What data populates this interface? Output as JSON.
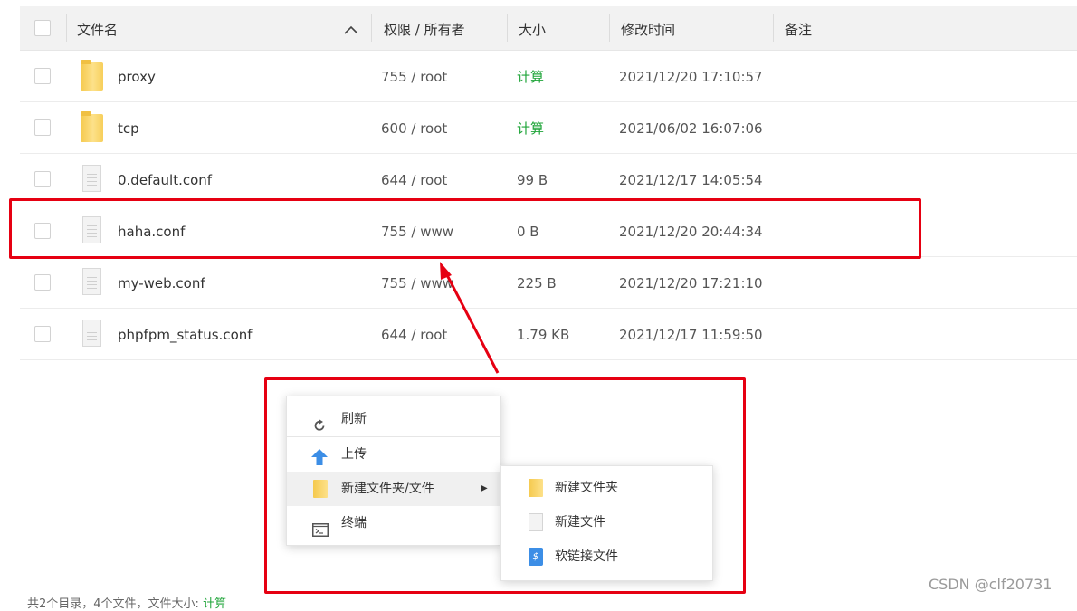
{
  "header": {
    "name": "文件名",
    "perm_owner": "权限 / 所有者",
    "size": "大小",
    "modified": "修改时间",
    "note": "备注"
  },
  "rows": [
    {
      "name": "proxy",
      "type": "folder",
      "perm": "755 / root",
      "size": "计算",
      "time": "2021/12/20 17:10:57"
    },
    {
      "name": "tcp",
      "type": "folder",
      "perm": "600 / root",
      "size": "计算",
      "time": "2021/06/02 16:07:06"
    },
    {
      "name": "0.default.conf",
      "type": "file",
      "perm": "644 / root",
      "size": "99 B",
      "time": "2021/12/17 14:05:54"
    },
    {
      "name": "haha.conf",
      "type": "file",
      "perm": "755 / www",
      "size": "0 B",
      "time": "2021/12/20 20:44:34"
    },
    {
      "name": "my-web.conf",
      "type": "file",
      "perm": "755 / www",
      "size": "225 B",
      "time": "2021/12/20 17:21:10"
    },
    {
      "name": "phpfpm_status.conf",
      "type": "file",
      "perm": "644 / root",
      "size": "1.79 KB",
      "time": "2021/12/17 11:59:50"
    }
  ],
  "context_menu": {
    "refresh": "刷新",
    "upload": "上传",
    "new_folder_file": "新建文件夹/文件",
    "terminal": "终端"
  },
  "submenu": {
    "new_folder": "新建文件夹",
    "new_file": "新建文件",
    "new_symlink": "软链接文件"
  },
  "footer": {
    "summary": "共2个目录，4个文件，文件大小:",
    "calc_link": "计算"
  },
  "watermark": "CSDN @clf20731",
  "colors": {
    "accent_green": "#20a53a",
    "highlight_red": "#e60012",
    "folder_yellow": "#f5c94d",
    "upload_blue": "#3c8ee6"
  }
}
